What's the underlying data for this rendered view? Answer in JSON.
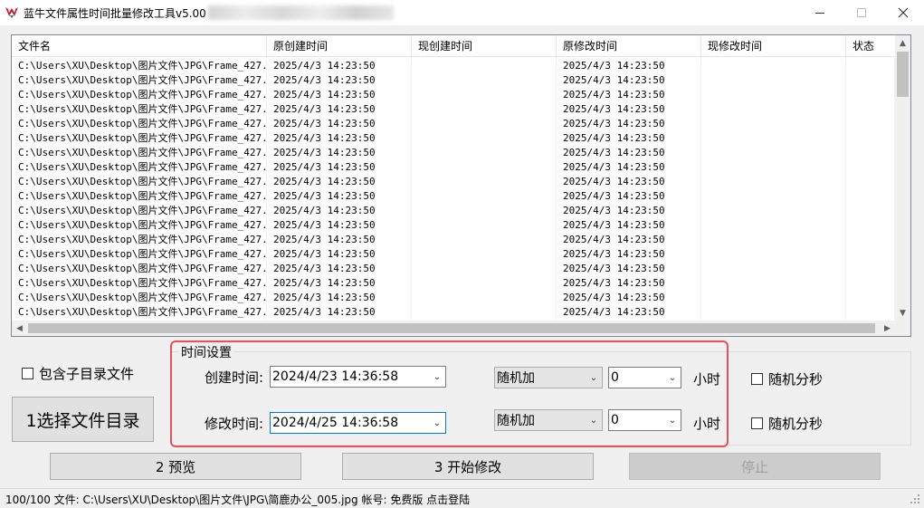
{
  "window": {
    "title": "蓝牛文件属性时间批量修改工具v5.00",
    "controls": {
      "minimize": "—",
      "close": "✕"
    }
  },
  "list": {
    "columns": [
      "文件名",
      "原创建时间",
      "现创建时间",
      "原修改时间",
      "现修改时间",
      "状态"
    ],
    "rows": [
      [
        "C:\\Users\\XU\\Desktop\\图片文件\\JPG\\Frame_427...",
        "2025/4/3 14:23:50",
        "",
        "2025/4/3 14:23:50",
        "",
        ""
      ],
      [
        "C:\\Users\\XU\\Desktop\\图片文件\\JPG\\Frame_427...",
        "2025/4/3 14:23:50",
        "",
        "2025/4/3 14:23:50",
        "",
        ""
      ],
      [
        "C:\\Users\\XU\\Desktop\\图片文件\\JPG\\Frame_427...",
        "2025/4/3 14:23:50",
        "",
        "2025/4/3 14:23:50",
        "",
        ""
      ],
      [
        "C:\\Users\\XU\\Desktop\\图片文件\\JPG\\Frame_427...",
        "2025/4/3 14:23:50",
        "",
        "2025/4/3 14:23:50",
        "",
        ""
      ],
      [
        "C:\\Users\\XU\\Desktop\\图片文件\\JPG\\Frame_427...",
        "2025/4/3 14:23:50",
        "",
        "2025/4/3 14:23:50",
        "",
        ""
      ],
      [
        "C:\\Users\\XU\\Desktop\\图片文件\\JPG\\Frame_427...",
        "2025/4/3 14:23:50",
        "",
        "2025/4/3 14:23:50",
        "",
        ""
      ],
      [
        "C:\\Users\\XU\\Desktop\\图片文件\\JPG\\Frame_427...",
        "2025/4/3 14:23:50",
        "",
        "2025/4/3 14:23:50",
        "",
        ""
      ],
      [
        "C:\\Users\\XU\\Desktop\\图片文件\\JPG\\Frame_427...",
        "2025/4/3 14:23:50",
        "",
        "2025/4/3 14:23:50",
        "",
        ""
      ],
      [
        "C:\\Users\\XU\\Desktop\\图片文件\\JPG\\Frame_427...",
        "2025/4/3 14:23:50",
        "",
        "2025/4/3 14:23:50",
        "",
        ""
      ],
      [
        "C:\\Users\\XU\\Desktop\\图片文件\\JPG\\Frame_427...",
        "2025/4/3 14:23:50",
        "",
        "2025/4/3 14:23:50",
        "",
        ""
      ],
      [
        "C:\\Users\\XU\\Desktop\\图片文件\\JPG\\Frame_427...",
        "2025/4/3 14:23:50",
        "",
        "2025/4/3 14:23:50",
        "",
        ""
      ],
      [
        "C:\\Users\\XU\\Desktop\\图片文件\\JPG\\Frame_427...",
        "2025/4/3 14:23:50",
        "",
        "2025/4/3 14:23:50",
        "",
        ""
      ],
      [
        "C:\\Users\\XU\\Desktop\\图片文件\\JPG\\Frame_427...",
        "2025/4/3 14:23:50",
        "",
        "2025/4/3 14:23:50",
        "",
        ""
      ],
      [
        "C:\\Users\\XU\\Desktop\\图片文件\\JPG\\Frame_427...",
        "2025/4/3 14:23:50",
        "",
        "2025/4/3 14:23:50",
        "",
        ""
      ],
      [
        "C:\\Users\\XU\\Desktop\\图片文件\\JPG\\Frame_427...",
        "2025/4/3 14:23:50",
        "",
        "2025/4/3 14:23:50",
        "",
        ""
      ],
      [
        "C:\\Users\\XU\\Desktop\\图片文件\\JPG\\Frame_427...",
        "2025/4/3 14:23:50",
        "",
        "2025/4/3 14:23:50",
        "",
        ""
      ],
      [
        "C:\\Users\\XU\\Desktop\\图片文件\\JPG\\Frame_427...",
        "2025/4/3 14:23:50",
        "",
        "2025/4/3 14:23:50",
        "",
        ""
      ],
      [
        "C:\\Users\\XU\\Desktop\\图片文件\\JPG\\Frame_427...",
        "2025/4/3 14:23:50",
        "",
        "2025/4/3 14:23:50",
        "",
        ""
      ]
    ]
  },
  "options": {
    "include_subdirs": "包含子目录文件",
    "select_dir_button": "1选择文件目录"
  },
  "time_settings": {
    "title": "时间设置",
    "create_label": "创建时间:",
    "create_value": "2024/4/23 14:36:58",
    "create_mode": "随机加",
    "create_amount": "0",
    "create_unit": "小时",
    "create_random_sec": "随机分秒",
    "modify_label": "修改时间:",
    "modify_value": "2024/4/25 14:36:58",
    "modify_mode": "随机加",
    "modify_amount": "0",
    "modify_unit": "小时",
    "modify_random_sec": "随机分秒"
  },
  "actions": {
    "preview": "2 预览",
    "start": "3 开始修改",
    "stop": "停止"
  },
  "status": {
    "text": "100/100 文件: C:\\Users\\XU\\Desktop\\图片文件\\JPG\\简鹿办公_005.jpg   帐号: 免费版 点击登陆"
  },
  "colors": {
    "highlight_border": "#e8505b",
    "focus_border": "#0078d7",
    "app_icon": "#c8202f"
  }
}
